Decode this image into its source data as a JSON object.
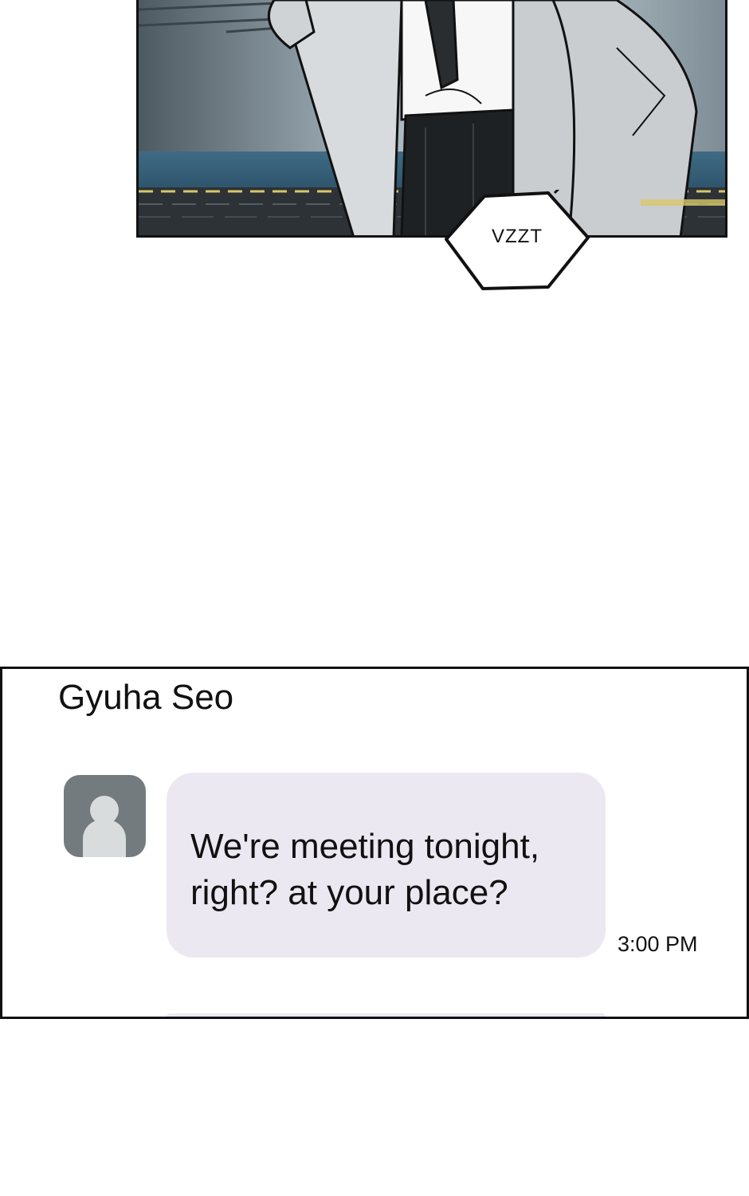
{
  "comic_panel": {
    "sound_effect": "VZZT"
  },
  "chat": {
    "contact_name": "Gyuha Seo",
    "messages": [
      {
        "text": "We're meeting tonight,\nright? at your place?",
        "time": "3:00 PM"
      }
    ]
  }
}
